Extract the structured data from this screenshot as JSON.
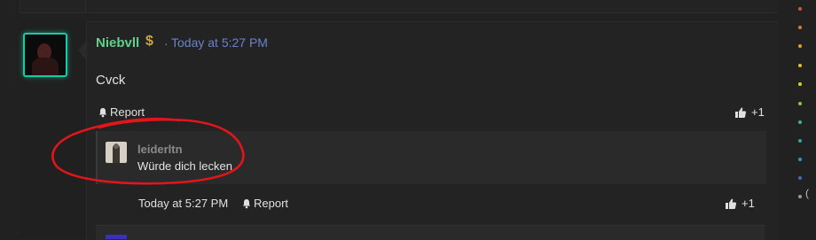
{
  "post": {
    "username": "Niebvll",
    "username_icon": "money-bag-icon",
    "separator": "·",
    "timestamp": "Today at 5:27 PM",
    "message": "Cvck",
    "report_label": "Report",
    "like_count": "+1"
  },
  "comment": {
    "username": "leiderltn",
    "text": "Würde dich lecken",
    "timestamp": "Today at 5:27 PM",
    "report_label": "Report",
    "like_count": "+1"
  },
  "activity": {
    "row_labels": [
      "",
      "",
      "",
      "",
      "",
      "",
      "",
      "",
      "",
      "",
      "",
      ""
    ],
    "last_label": "("
  },
  "colors": {
    "accent_teal": "#19c9a4",
    "username_green": "#5fd18b",
    "timestamp_blue": "#6a83c9",
    "annotation_red": "#e0161a"
  }
}
